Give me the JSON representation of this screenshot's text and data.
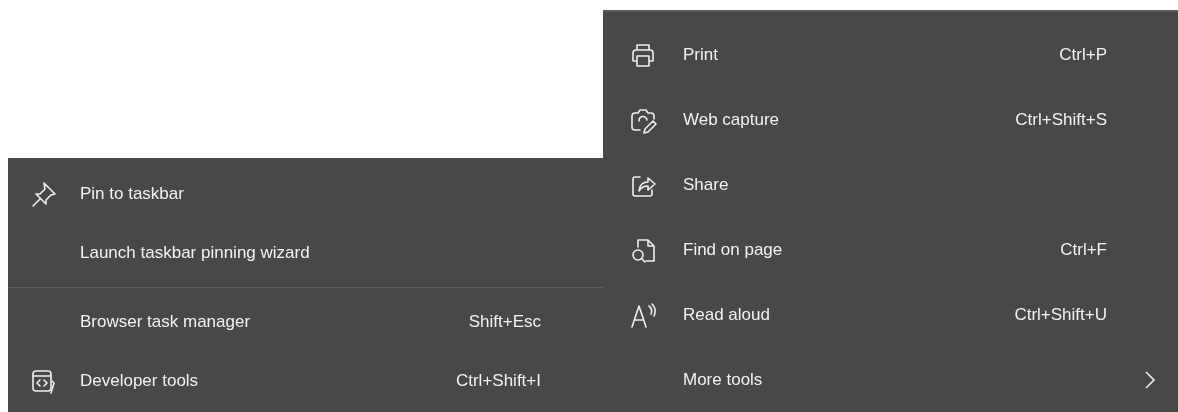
{
  "menus": [
    {
      "items": [
        {
          "kind": "item",
          "label": "Pin to taskbar",
          "submenu": false
        },
        {
          "kind": "item",
          "label": "Launch taskbar pinning wizard",
          "submenu": false
        },
        {
          "kind": "separator"
        },
        {
          "kind": "item",
          "label": "Browser task manager",
          "shortcut": "Shift+Esc",
          "submenu": false
        },
        {
          "kind": "item",
          "label": "Developer tools",
          "shortcut": "Ctrl+Shift+I",
          "submenu": false
        }
      ]
    },
    {
      "items": [
        {
          "kind": "item",
          "label": "Print",
          "shortcut": "Ctrl+P",
          "submenu": false
        },
        {
          "kind": "item",
          "label": "Web capture",
          "shortcut": "Ctrl+Shift+S",
          "submenu": false
        },
        {
          "kind": "item",
          "label": "Share",
          "submenu": false
        },
        {
          "kind": "item",
          "label": "Find on page",
          "shortcut": "Ctrl+F",
          "submenu": false
        },
        {
          "kind": "item",
          "label": "Read aloud",
          "shortcut": "Ctrl+Shift+U",
          "submenu": false
        },
        {
          "kind": "item",
          "label": "More tools",
          "submenu": true
        }
      ]
    }
  ]
}
